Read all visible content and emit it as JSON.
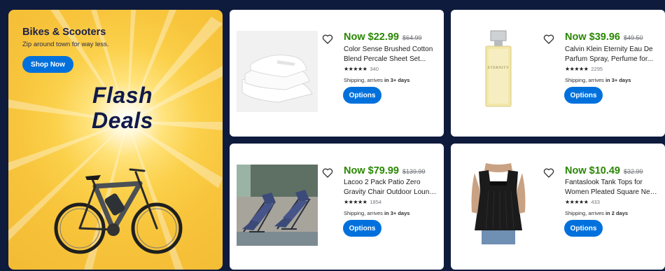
{
  "promo": {
    "title": "Bikes & Scooters",
    "subtitle": "Zip around town for way less.",
    "shop_now": "Shop Now",
    "flash_line1": "Flash",
    "flash_line2": "Deals",
    "accent_color": "#f7c43b"
  },
  "products": [
    {
      "price": "Now $22.99",
      "was_price": "$64.99",
      "title_line1": "Color Sense Brushed Cotton",
      "title_line2": "Blend Percale Sheet Set...",
      "stars": "★★★★★",
      "rating_count": "340",
      "ship_prefix": "Shipping, arrives",
      "ship_days": "in 3+ days",
      "button": "Options",
      "image": "white-pillows-image"
    },
    {
      "price": "Now $39.96",
      "was_price": "$49.50",
      "title_line1": "Calvin Klein Eternity Eau De",
      "title_line2": "Parfum Spray, Perfume for...",
      "stars": "★★★★★",
      "rating_count": "2295",
      "ship_prefix": "Shipping, arrives",
      "ship_days": "in 3+ days",
      "button": "Options",
      "image": "perfume-bottle-image",
      "bottle_label": "ETERNITY"
    },
    {
      "price": "Now $79.99",
      "was_price": "$139.99",
      "title_line1": "Lacoo 2 Pack Patio Zero",
      "title_line2": "Gravity Chair Outdoor Loung...",
      "stars": "★★★★★",
      "rating_count": "1854",
      "ship_prefix": "Shipping, arrives",
      "ship_days": "in 3+ days",
      "button": "Options",
      "image": "patio-chairs-image"
    },
    {
      "price": "Now $10.49",
      "was_price": "$32.99",
      "title_line1": "Fantaslook Tank Tops for",
      "title_line2": "Women Pleated Square Neck...",
      "stars": "★★★★★",
      "rating_count": "433",
      "ship_prefix": "Shipping, arrives",
      "ship_days": "in 2 days",
      "button": "Options",
      "image": "black-tank-top-image"
    }
  ],
  "colors": {
    "background": "#0e1b3d",
    "price_green": "#2a8703",
    "button_blue": "#0071dc"
  }
}
